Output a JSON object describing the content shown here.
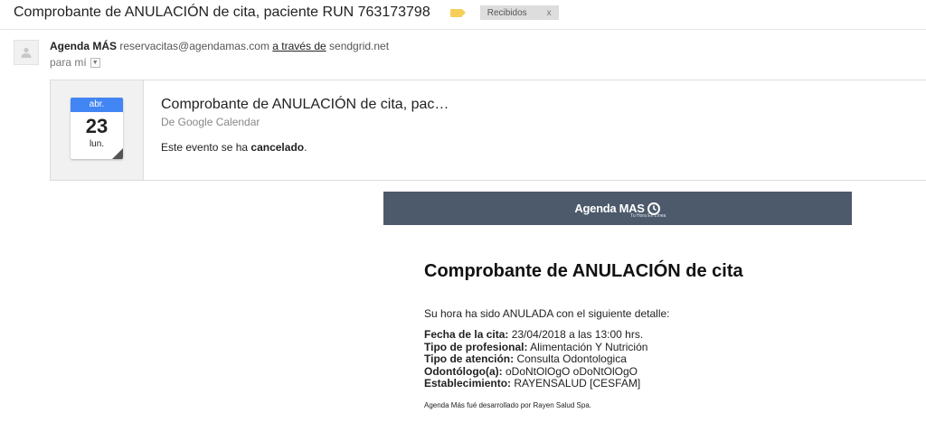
{
  "email": {
    "subject": "Comprobante de ANULACIÓN de cita, paciente RUN 763173798",
    "label_color": "#f6cf5b",
    "inbox_label": "Recibidos",
    "inbox_label_close": "x",
    "sender": {
      "name": "Agenda MÁS",
      "address": "reservacitas@agendamas.com",
      "via_text": "a través de",
      "via_domain": "sendgrid.net"
    },
    "to_text": "para mí",
    "to_dropdown_icon": "chevron-down-icon"
  },
  "invite": {
    "calendar_month": "abr.",
    "calendar_day": "23",
    "calendar_weekday": "lun.",
    "title": "Comprobante de ANULACIÓN de cita, pac…",
    "source": "De Google Calendar",
    "message_prefix": "Este evento se ha ",
    "message_bold": "cancelado",
    "message_suffix": ".",
    "accent_color": "#4285f4"
  },
  "body": {
    "banner_color": "#4c5a6b",
    "logo_text": "Agenda MAS",
    "logo_tagline": "Tu Hora En Línea",
    "title": "Comprobante de ANULACIÓN de cita",
    "intro": "Su hora ha sido ANULADA con el siguiente detalle:",
    "details": [
      {
        "label": "Fecha de la cita:",
        "value": " 23/04/2018 a las 13:00 hrs."
      },
      {
        "label": "Tipo de profesional:",
        "value": " Alimentación Y Nutrición"
      },
      {
        "label": "Tipo de atención:",
        "value": " Consulta Odontologica"
      },
      {
        "label": "Odontólogo(a):",
        "value": " oDoNtOlOgO oDoNtOlOgO"
      },
      {
        "label": "Establecimiento:",
        "value": " RAYENSALUD [CESFAM]"
      }
    ],
    "footer": "Agenda Más fué desarrollado por Rayen Salud Spa."
  }
}
